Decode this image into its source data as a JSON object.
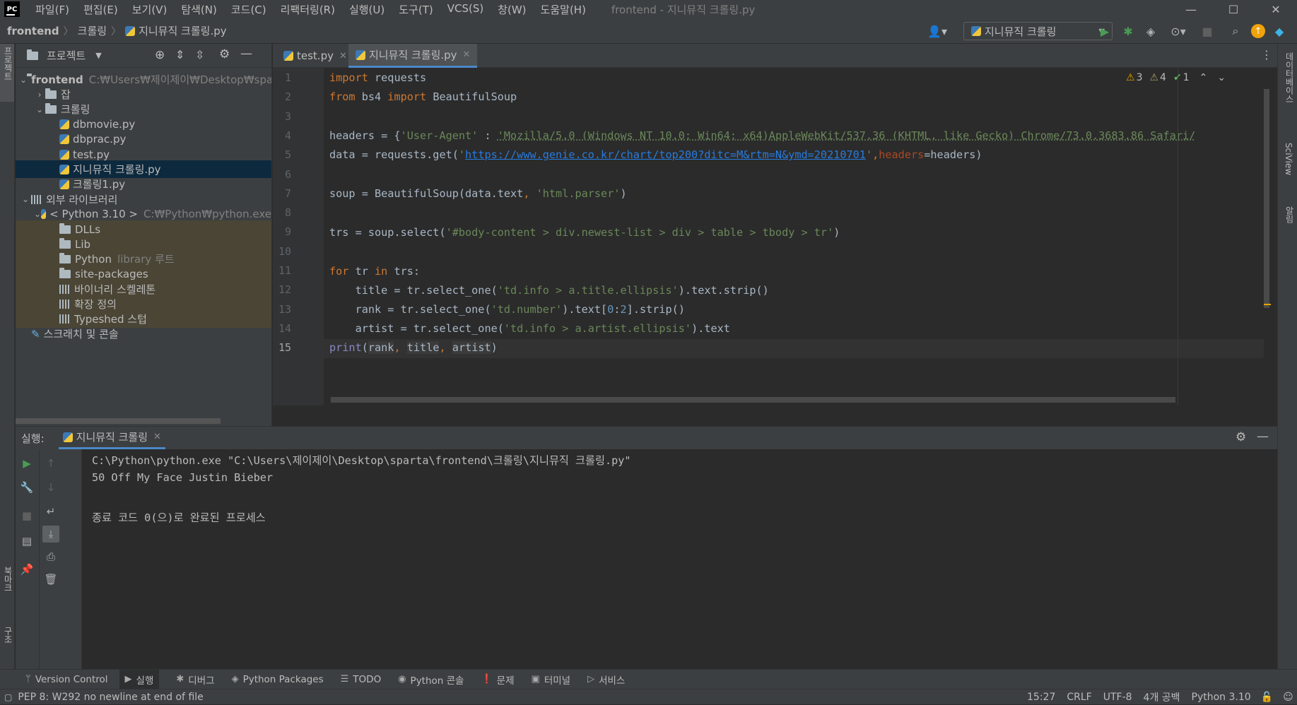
{
  "menu": [
    "파일(F)",
    "편집(E)",
    "보기(V)",
    "탐색(N)",
    "코드(C)",
    "리팩터링(R)",
    "실행(U)",
    "도구(T)",
    "VCS(S)",
    "창(W)",
    "도움말(H)"
  ],
  "window_title": "frontend - 지니뮤직 크롤링.py",
  "breadcrumb": [
    "frontend",
    "크롤링",
    "지니뮤직 크롤링.py"
  ],
  "run_config": "지니뮤직 크롤링",
  "left_tool_labels": {
    "project": "프로젝트",
    "bookmarks": "북마크",
    "structure": "구조"
  },
  "right_tool_labels": {
    "database": "데이터베이스",
    "sciview": "SciView",
    "notifications": "알림"
  },
  "project_panel": {
    "title": "프로젝트",
    "tree": [
      {
        "label": "frontend",
        "path": "C:₩Users₩제이제이₩Desktop₩sparta₩frontend",
        "type": "folder",
        "depth": 0,
        "expanded": true
      },
      {
        "label": "잡",
        "type": "folder",
        "depth": 1,
        "expanded": false
      },
      {
        "label": "크롤링",
        "type": "folder",
        "depth": 1,
        "expanded": true
      },
      {
        "label": "dbmovie.py",
        "type": "py",
        "depth": 2
      },
      {
        "label": "dbprac.py",
        "type": "py",
        "depth": 2
      },
      {
        "label": "test.py",
        "type": "py",
        "depth": 2
      },
      {
        "label": "지니뮤직 크롤링.py",
        "type": "py",
        "depth": 2,
        "selected": true
      },
      {
        "label": "크롤링1.py",
        "type": "py",
        "depth": 2
      },
      {
        "label": "외부 라이브러리",
        "type": "lib",
        "depth": 0,
        "expanded": true
      },
      {
        "label": "< Python 3.10 >",
        "path": "C:₩Python₩python.exe",
        "type": "python",
        "depth": 1,
        "expanded": true
      },
      {
        "label": "DLLs",
        "type": "folder",
        "depth": 2,
        "lib": true
      },
      {
        "label": "Lib",
        "type": "folder",
        "depth": 2,
        "lib": true
      },
      {
        "label": "Python",
        "path": "library 루트",
        "type": "folder",
        "depth": 2,
        "lib": true
      },
      {
        "label": "site-packages",
        "type": "folder",
        "depth": 2,
        "lib": true
      },
      {
        "label": "바이너리 스켈레톤",
        "type": "lib",
        "depth": 2,
        "lib": true
      },
      {
        "label": "확장 정의",
        "type": "lib",
        "depth": 2,
        "lib": true
      },
      {
        "label": "Typeshed 스텁",
        "type": "lib",
        "depth": 2,
        "lib": true
      },
      {
        "label": "스크래치 및 콘솔",
        "type": "scratch",
        "depth": 0
      }
    ]
  },
  "editor": {
    "tabs": [
      {
        "label": "test.py",
        "active": false
      },
      {
        "label": "지니뮤직 크롤링.py",
        "active": true
      }
    ],
    "inspections": {
      "warnings": "3",
      "weak_warnings": "4",
      "ok": "1"
    },
    "line_numbers": [
      "1",
      "2",
      "3",
      "4",
      "5",
      "6",
      "7",
      "8",
      "9",
      "10",
      "11",
      "12",
      "13",
      "14",
      "15"
    ],
    "current_line": "15"
  },
  "run_panel": {
    "label": "실행:",
    "tab": "지니뮤직 크롤링",
    "output": [
      "C:\\Python\\python.exe \"C:\\Users\\제이제이\\Desktop\\sparta\\frontend\\크롤링\\지니뮤직 크롤링.py\"",
      "50 Off My Face Justin Bieber",
      "",
      "종료 코드 0(으)로 완료된 프로세스"
    ]
  },
  "bottom_tabs": [
    "Version Control",
    "실행",
    "디버그",
    "Python Packages",
    "TODO",
    "Python 콘솔",
    "문제",
    "터미널",
    "서비스"
  ],
  "status": {
    "message": "PEP 8: W292 no newline at end of file",
    "position": "15:27",
    "line_sep": "CRLF",
    "encoding": "UTF-8",
    "indent": "4개 공백",
    "interpreter": "Python 3.10"
  }
}
